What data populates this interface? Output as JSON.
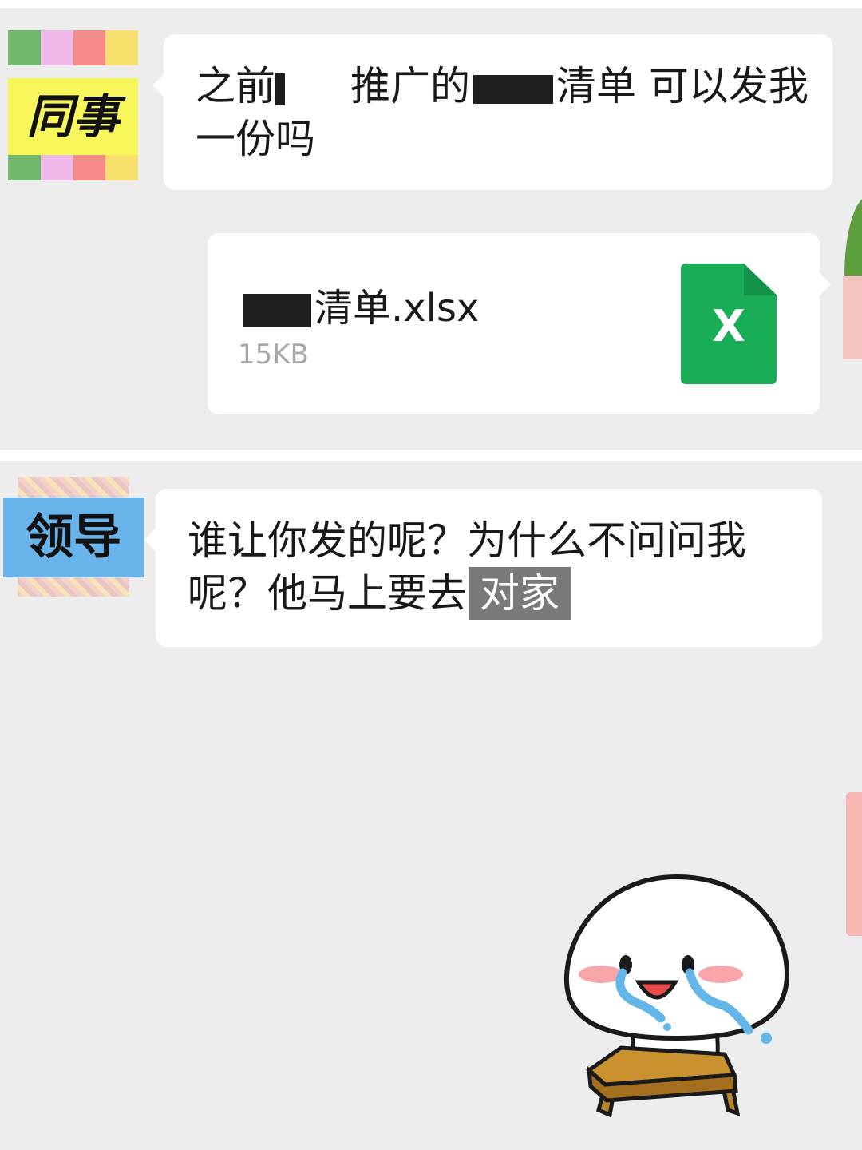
{
  "messages": [
    {
      "sender_label": "同事",
      "text_parts": [
        "之前",
        "推广的",
        "清单 可以发我一份吗"
      ]
    },
    {
      "type": "file",
      "file_name": "清单.xlsx",
      "file_size": "15KB",
      "file_icon_letter": "X",
      "icon_color": "#1aad57"
    },
    {
      "sender_label": "领导",
      "text": "谁让你发的呢？为什么不问问我呢？他马上要去",
      "highlighted_text": "对家"
    }
  ],
  "sticker": "crying-bun-sticker",
  "colors": {
    "background": "#ededed",
    "bubble": "#ffffff",
    "coworker_avatar": "#f7f65a",
    "leader_avatar": "#68b3e9"
  }
}
